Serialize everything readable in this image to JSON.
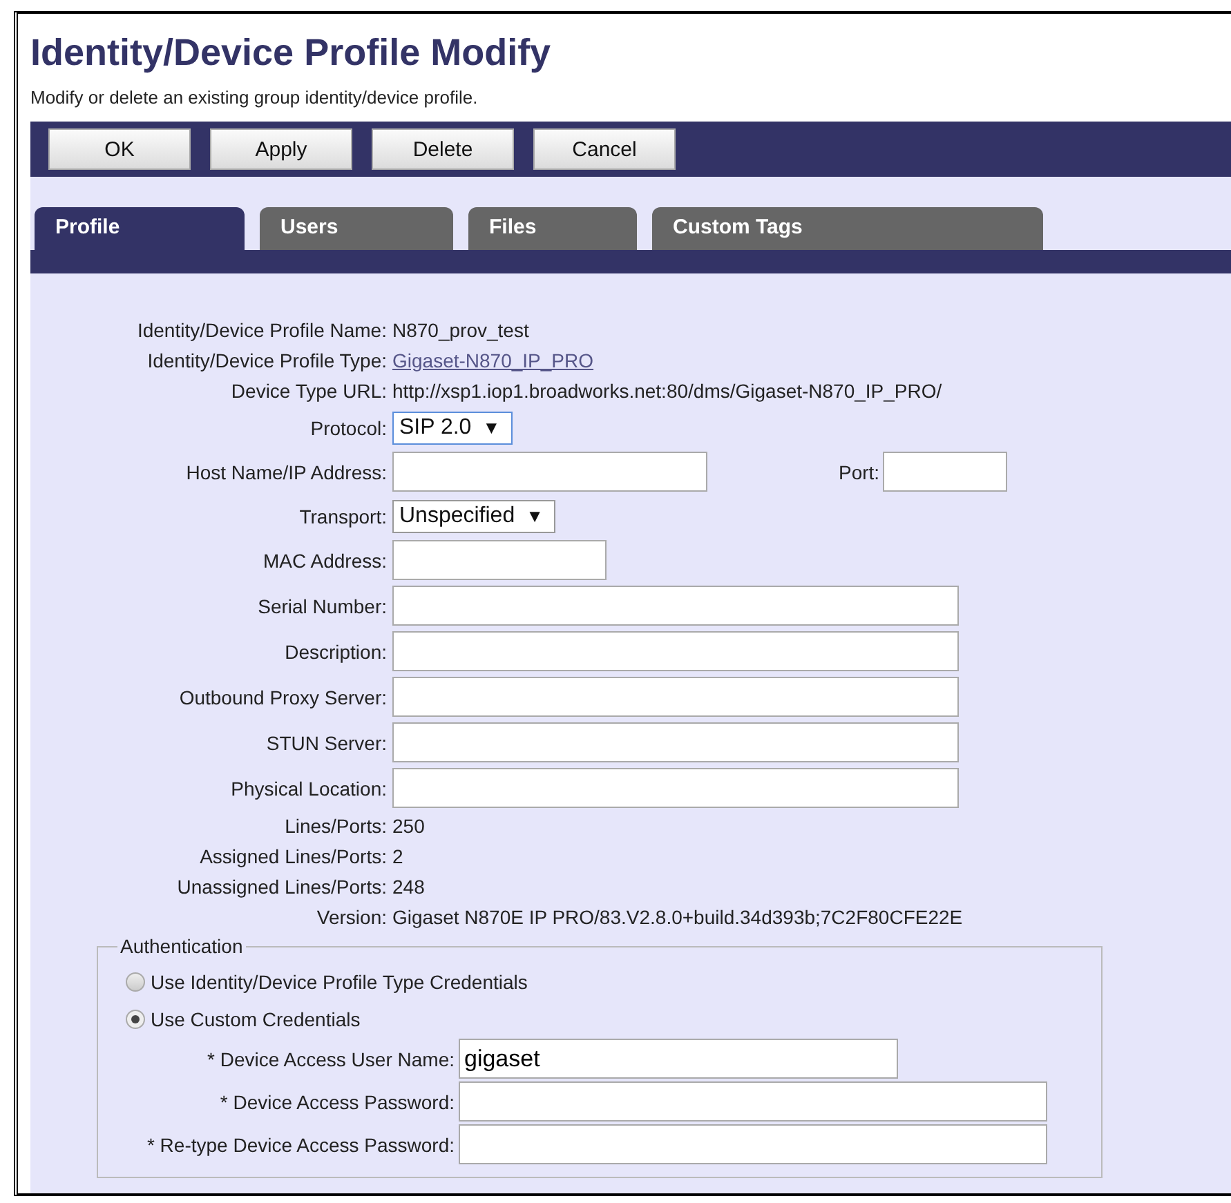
{
  "title": "Identity/Device Profile Modify",
  "subtitle": "Modify or delete an existing group identity/device profile.",
  "buttons": [
    "OK",
    "Apply",
    "Delete",
    "Cancel"
  ],
  "tabs": [
    {
      "label": "Profile",
      "selected": true
    },
    {
      "label": "Users",
      "selected": false
    },
    {
      "label": "Files",
      "selected": false
    },
    {
      "label": "Custom Tags",
      "selected": false
    }
  ],
  "fields": [
    {
      "kind": "text",
      "label": "Identity/Device Profile Name:",
      "value": "N870_prov_test"
    },
    {
      "kind": "link",
      "label": "Identity/Device Profile Type:",
      "value": "Gigaset-N870_IP_PRO"
    },
    {
      "kind": "text",
      "label": "Device Type URL:",
      "value": "http://xsp1.iop1.broadworks.net:80/dms/Gigaset-N870_IP_PRO/"
    },
    {
      "kind": "select",
      "label": "Protocol:",
      "value": "SIP 2.0",
      "arrow": "▼"
    },
    {
      "kind": "input",
      "label": "Host Name/IP Address:",
      "extra": {
        "label": "Port:"
      }
    },
    {
      "kind": "select",
      "label": "Transport:",
      "value": "Unspecified",
      "arrow": "▼"
    },
    {
      "kind": "input",
      "label": "MAC Address:"
    },
    {
      "kind": "input",
      "label": "Serial Number:"
    },
    {
      "kind": "input",
      "label": "Description:"
    },
    {
      "kind": "input",
      "label": "Outbound Proxy Server:"
    },
    {
      "kind": "input",
      "label": "STUN Server:"
    },
    {
      "kind": "input",
      "label": "Physical Location:"
    },
    {
      "kind": "text",
      "label": "Lines/Ports:",
      "value": "250"
    },
    {
      "kind": "text",
      "label": "Assigned Lines/Ports:",
      "value": "2"
    },
    {
      "kind": "text",
      "label": "Unassigned Lines/Ports:",
      "value": "248"
    },
    {
      "kind": "text",
      "label": "Version:",
      "value": "Gigaset N870E IP PRO/83.V2.8.0+build.34d393b;7C2F80CFE22E"
    }
  ],
  "authentication": {
    "legend": "Authentication",
    "radios": [
      {
        "label": "Use Identity/Device Profile Type Credentials",
        "selected": false
      },
      {
        "label": "Use Custom Credentials",
        "selected": true
      }
    ],
    "fields": [
      {
        "label": "* Device Access User Name:",
        "value": "gigaset"
      },
      {
        "label": "* Device Access Password:"
      },
      {
        "label": "* Re-type Device Access Password:"
      }
    ]
  }
}
